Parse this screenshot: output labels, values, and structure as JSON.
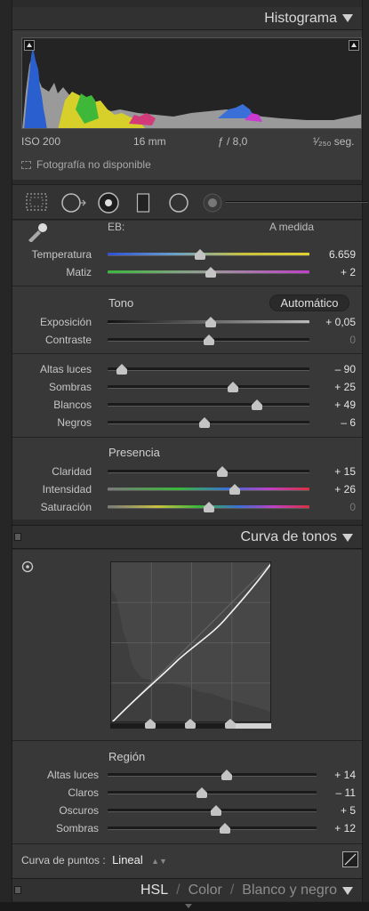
{
  "histogram": {
    "title": "Histograma",
    "iso": "ISO 200",
    "focal": "16 mm",
    "aperture": "ƒ / 8,0",
    "shutter": "¹⁄₂₅₀ seg.",
    "photo_status": "Fotografía no disponible"
  },
  "tools": [
    "crop-overlay-icon",
    "spot-removal-icon",
    "red-eye-icon",
    "graduated-filter-icon",
    "radial-filter-icon",
    "adjustment-brush-icon"
  ],
  "basic": {
    "wb_label": "EB:",
    "wb_value": "A medida",
    "temperature": {
      "label": "Temperatura",
      "value": "6.659",
      "pos": 0.46
    },
    "tint": {
      "label": "Matiz",
      "value": "+ 2",
      "pos": 0.51
    },
    "tone_title": "Tono",
    "auto_label": "Automático",
    "exposure": {
      "label": "Exposición",
      "value": "+ 0,05",
      "pos": 0.51
    },
    "contrast": {
      "label": "Contraste",
      "value": "0",
      "pos": 0.5
    },
    "highlights": {
      "label": "Altas luces",
      "value": "– 90",
      "pos": 0.07
    },
    "shadows": {
      "label": "Sombras",
      "value": "+ 25",
      "pos": 0.62
    },
    "whites": {
      "label": "Blancos",
      "value": "+ 49",
      "pos": 0.74
    },
    "blacks": {
      "label": "Negros",
      "value": "– 6",
      "pos": 0.48
    },
    "presence_title": "Presencia",
    "clarity": {
      "label": "Claridad",
      "value": "+ 15",
      "pos": 0.57
    },
    "vibrance": {
      "label": "Intensidad",
      "value": "+ 26",
      "pos": 0.63
    },
    "saturation": {
      "label": "Saturación",
      "value": "0",
      "pos": 0.5
    }
  },
  "tone_curve": {
    "title": "Curva de tonos",
    "region_title": "Región",
    "highlights": {
      "label": "Altas luces",
      "value": "+ 14",
      "pos": 0.57
    },
    "lights": {
      "label": "Claros",
      "value": "– 11",
      "pos": 0.45
    },
    "darks": {
      "label": "Oscuros",
      "value": "+ 5",
      "pos": 0.52
    },
    "shadows": {
      "label": "Sombras",
      "value": "+ 12",
      "pos": 0.56
    },
    "point_curve_label": "Curva de puntos :",
    "point_curve_value": "Lineal"
  },
  "hsl": {
    "tab_hsl": "HSL",
    "tab_color": "Color",
    "tab_bw": "Blanco y negro"
  },
  "colors": {
    "panel_bg": "#383838",
    "header_bg": "#313131",
    "text": "#c8c8c8",
    "value_text": "#e4e4e4"
  }
}
